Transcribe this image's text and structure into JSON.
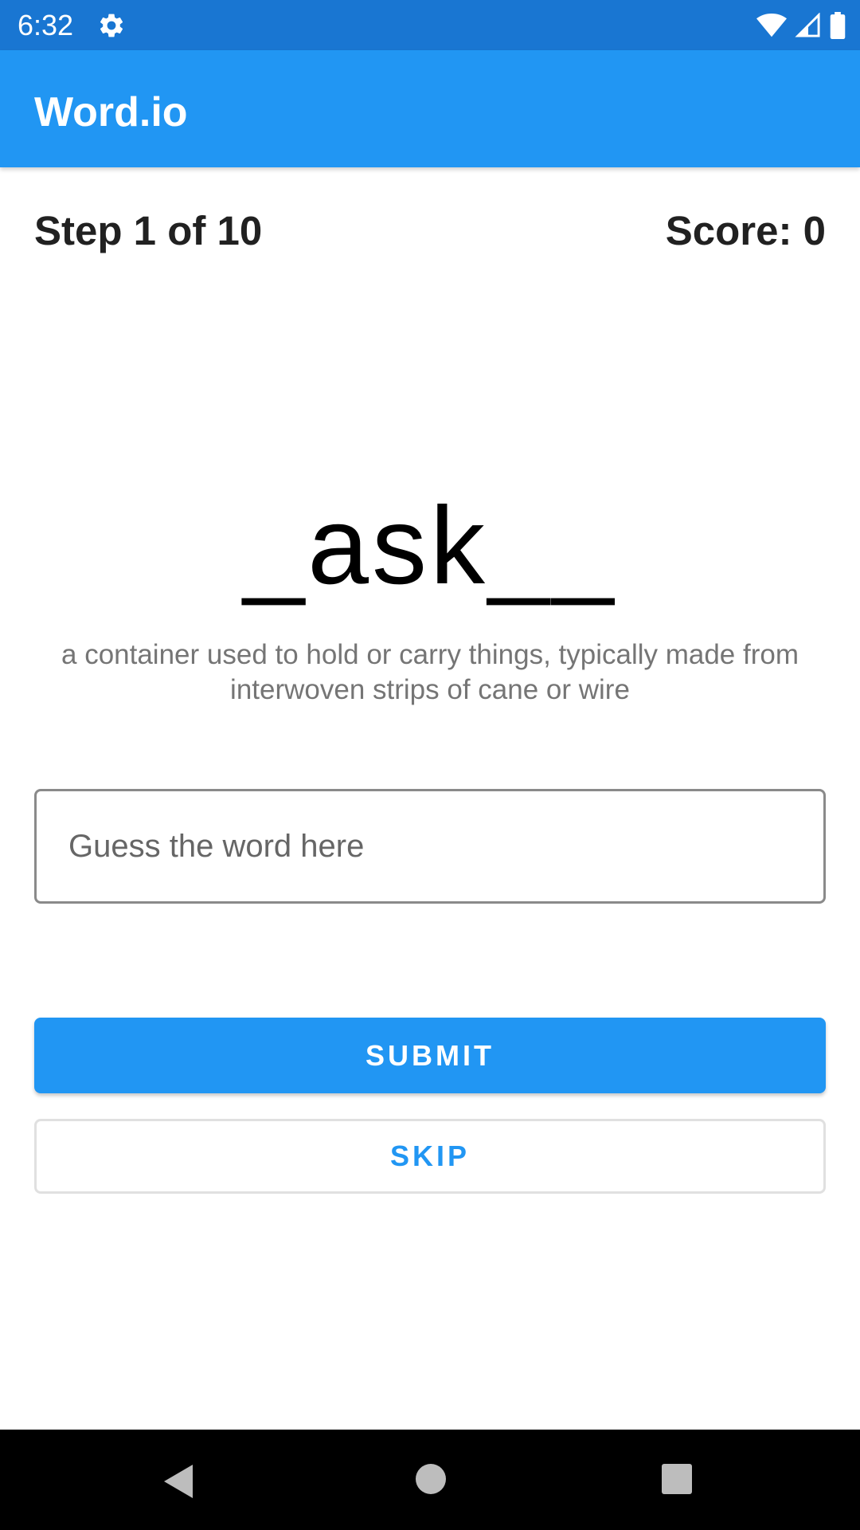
{
  "status_bar": {
    "time": "6:32",
    "icons": [
      "gear-icon",
      "wifi-icon",
      "cellular-signal-icon",
      "battery-icon"
    ]
  },
  "app_bar": {
    "title": "Word.io"
  },
  "game": {
    "step_label": "Step 1 of 10",
    "score_label": "Score: 0",
    "word_puzzle": "_ask__",
    "hint": "a container used to hold or carry things, typically made from interwoven strips of cane or wire"
  },
  "guess_input": {
    "value": "",
    "placeholder": "Guess the word here"
  },
  "buttons": {
    "submit_label": "SUBMIT",
    "skip_label": "SKIP"
  },
  "nav_bar": {
    "icons": [
      "back-icon",
      "home-icon",
      "recents-icon"
    ]
  },
  "colors": {
    "status_bar": "#1976d2",
    "app_bar": "#2196f3",
    "accent": "#2196f3"
  }
}
